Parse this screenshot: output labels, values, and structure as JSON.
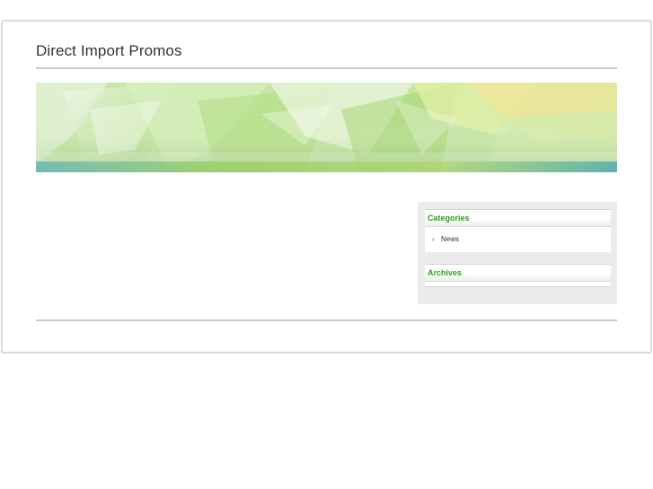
{
  "site": {
    "title": "Direct Import Promos"
  },
  "sidebar": {
    "categories": {
      "title": "Categories",
      "items": [
        {
          "label": "News"
        }
      ]
    },
    "archives": {
      "title": "Archives"
    }
  },
  "colors": {
    "widget_title": "#2e9e1f",
    "sidebar_bg": "#ebebeb",
    "rule": "#c9c9c9"
  },
  "icons": {
    "list_bullet": "chevron-right-icon"
  }
}
